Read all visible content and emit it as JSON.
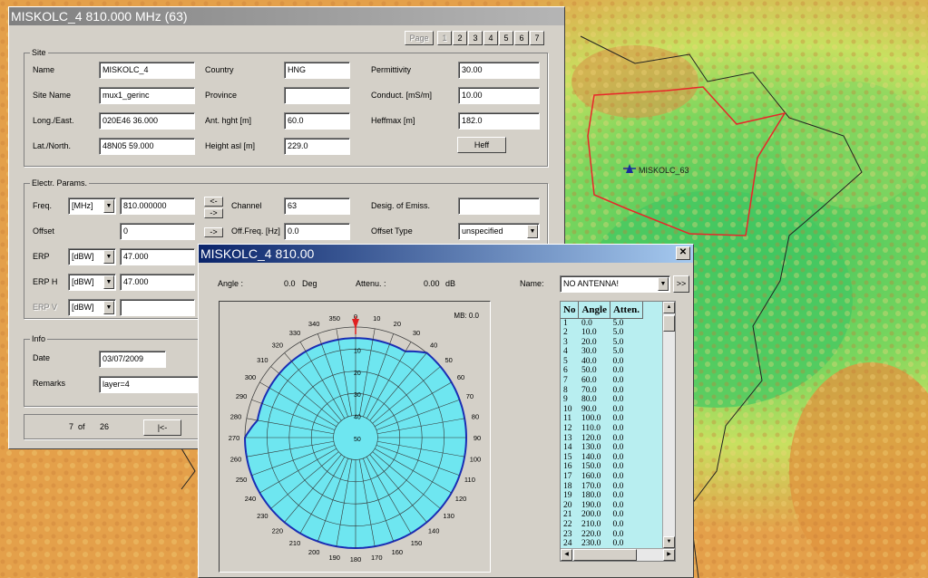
{
  "map": {
    "site_label": "MISKOLC_63",
    "coverage_color": "#e8262a",
    "terrain_colors": [
      "#e4a04a",
      "#f0d060",
      "#b4e05a",
      "#6ed060",
      "#3cc460"
    ]
  },
  "site_window": {
    "title": "MISKOLC_4  810.000 MHz  (63)",
    "page_label": "Page",
    "pages": [
      "1",
      "2",
      "3",
      "4",
      "5",
      "6",
      "7"
    ],
    "site_group": {
      "legend": "Site",
      "name_label": "Name",
      "name_value": "MISKOLC_4",
      "site_name_label": "Site Name",
      "site_name_value": "mux1_gerinc",
      "long_label": "Long./East.",
      "long_value": "020E46 36.000",
      "lat_label": "Lat./North.",
      "lat_value": "48N05 59.000",
      "country_label": "Country",
      "country_value": "HNG",
      "province_label": "Province",
      "province_value": "",
      "ant_hght_label": "Ant. hght [m]",
      "ant_hght_value": "60.0",
      "height_asl_label": "Height asl [m]",
      "height_asl_value": "229.0",
      "permittivity_label": "Permittivity",
      "permittivity_value": "30.00",
      "conduct_label": "Conduct. [mS/m]",
      "conduct_value": "10.00",
      "heffmax_label": "Heffmax [m]",
      "heffmax_value": "182.0",
      "heff_button": "Heff"
    },
    "electr_group": {
      "legend": "Electr. Params.",
      "freq_label": "Freq.",
      "freq_unit": "[MHz]",
      "freq_value": "810.000000",
      "arrow_left": "<-",
      "arrow_right": "->",
      "arrow_right2": "->",
      "channel_label": "Channel",
      "channel_value": "63",
      "desig_label": "Desig. of Emiss.",
      "desig_value": "",
      "offset_label": "Offset",
      "offset_value": "0",
      "off_freq_label": "Off.Freq. [Hz]",
      "off_freq_value": "0.0",
      "offset_type_label": "Offset Type",
      "offset_type_value": "unspecified",
      "erp_label": "ERP",
      "erp_unit": "[dBW]",
      "erp_value": "47.000",
      "erph_label": "ERP H",
      "erph_unit": "[dBW]",
      "erph_value": "47.000",
      "erpv_label": "ERP V",
      "erpv_unit": "[dBW]",
      "erpv_value": ""
    },
    "info_group": {
      "legend": "Info",
      "date_label": "Date",
      "date_value": "03/07/2009",
      "remarks_label": "Remarks",
      "remarks_value": "layer=4"
    },
    "nav": {
      "position": "7",
      "of_label": "of",
      "total": "26",
      "first_button": "|<-"
    }
  },
  "antenna_window": {
    "title": "MISKOLC_4  810.00",
    "close_label": "✕",
    "angle_label": "Angle :",
    "angle_value": "0.0",
    "angle_unit": "Deg",
    "atten_label": "Attenu. :",
    "atten_value": "0.00",
    "atten_unit": "dB",
    "name_label": "Name:",
    "name_value": "NO ANTENNA!",
    "more_button": ">>",
    "mb_label": "MB: 0.0",
    "columns": [
      "No",
      "Angle",
      "Atten."
    ],
    "rows": [
      [
        "1",
        "0.0",
        "5.0"
      ],
      [
        "2",
        "10.0",
        "5.0"
      ],
      [
        "3",
        "20.0",
        "5.0"
      ],
      [
        "4",
        "30.0",
        "5.0"
      ],
      [
        "5",
        "40.0",
        "0.0"
      ],
      [
        "6",
        "50.0",
        "0.0"
      ],
      [
        "7",
        "60.0",
        "0.0"
      ],
      [
        "8",
        "70.0",
        "0.0"
      ],
      [
        "9",
        "80.0",
        "0.0"
      ],
      [
        "10",
        "90.0",
        "0.0"
      ],
      [
        "11",
        "100.0",
        "0.0"
      ],
      [
        "12",
        "110.0",
        "0.0"
      ],
      [
        "13",
        "120.0",
        "0.0"
      ],
      [
        "14",
        "130.0",
        "0.0"
      ],
      [
        "15",
        "140.0",
        "0.0"
      ],
      [
        "16",
        "150.0",
        "0.0"
      ],
      [
        "17",
        "160.0",
        "0.0"
      ],
      [
        "18",
        "170.0",
        "0.0"
      ],
      [
        "19",
        "180.0",
        "0.0"
      ],
      [
        "20",
        "190.0",
        "0.0"
      ],
      [
        "21",
        "200.0",
        "0.0"
      ],
      [
        "22",
        "210.0",
        "0.0"
      ],
      [
        "23",
        "220.0",
        "0.0"
      ],
      [
        "24",
        "230.0",
        "0.0"
      ]
    ],
    "polar": {
      "fill_color": "#6ee6f0",
      "outline_color": "#1a2db4",
      "ring_labels": [
        "10",
        "20",
        "30",
        "40",
        "50"
      ],
      "attenuation_db": [
        5,
        5,
        5,
        5,
        0,
        0,
        0,
        0,
        0,
        0,
        0,
        0,
        0,
        0,
        0,
        0,
        0,
        0,
        0,
        0,
        0,
        0,
        0,
        0,
        0,
        0,
        0,
        0,
        5,
        5,
        5,
        5,
        5,
        5,
        5,
        5
      ],
      "angle_labels": [
        "0",
        "10",
        "20",
        "30",
        "40",
        "50",
        "60",
        "70",
        "80",
        "90",
        "100",
        "110",
        "120",
        "130",
        "140",
        "150",
        "160",
        "170",
        "180",
        "190",
        "200",
        "210",
        "220",
        "230",
        "240",
        "250",
        "260",
        "270",
        "280",
        "290",
        "300",
        "310",
        "320",
        "330",
        "340",
        "350"
      ]
    }
  }
}
